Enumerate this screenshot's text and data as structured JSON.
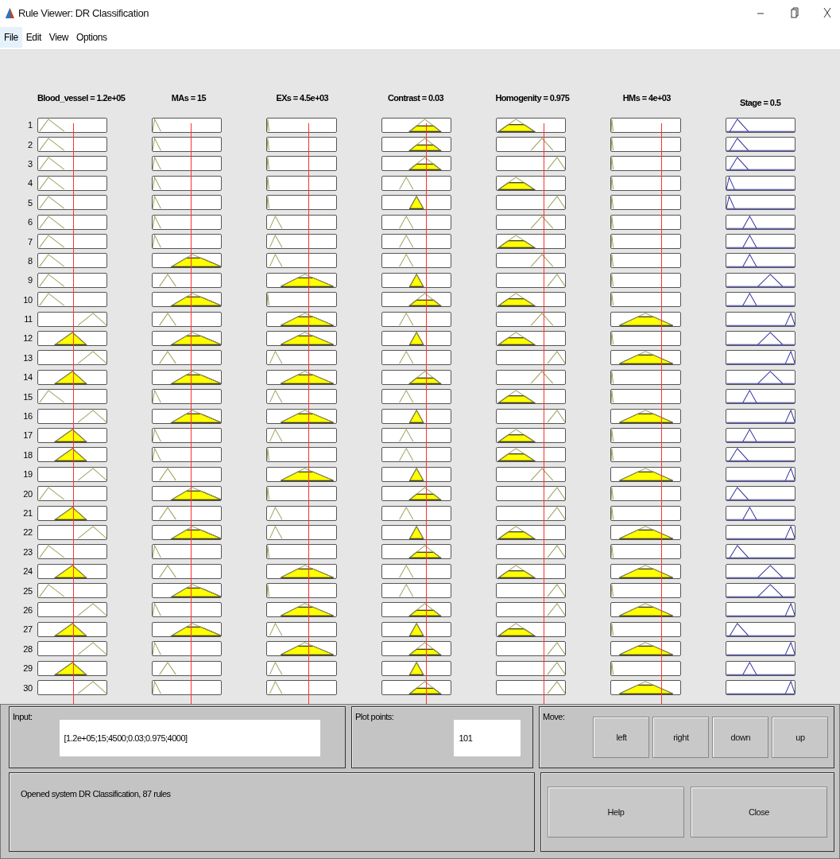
{
  "window": {
    "title": "Rule Viewer: DR Classification"
  },
  "menu": [
    {
      "label": "File",
      "selected": true
    },
    {
      "label": "Edit",
      "selected": false
    },
    {
      "label": "View",
      "selected": false
    },
    {
      "label": "Options",
      "selected": false
    }
  ],
  "variables": [
    {
      "label": "Blood_vessel = 1.2e+05",
      "kind": "input"
    },
    {
      "label": "MAs = 15",
      "kind": "input"
    },
    {
      "label": "EXs = 4.5e+03",
      "kind": "input"
    },
    {
      "label": "Contrast = 0.03",
      "kind": "input"
    },
    {
      "label": "Homogenity = 0.975",
      "kind": "input"
    },
    {
      "label": "HMs = 4e+03",
      "kind": "input"
    },
    {
      "label": "Stage = 0.5",
      "kind": "output"
    }
  ],
  "rules": [
    {
      "number": "1",
      "cells": [
        {
          "kind": "low",
          "fired": false
        },
        {
          "kind": "edge",
          "fired": false
        },
        {
          "kind": "edge",
          "fired": false
        },
        {
          "kind": "high",
          "fired": true
        },
        {
          "kind": "low",
          "fired": true
        },
        {
          "kind": "edge",
          "fired": false
        },
        {
          "kind": "s1"
        }
      ]
    },
    {
      "number": "2",
      "cells": [
        {
          "kind": "low",
          "fired": false
        },
        {
          "kind": "edge",
          "fired": false
        },
        {
          "kind": "edge",
          "fired": false
        },
        {
          "kind": "high",
          "fired": true
        },
        {
          "kind": "mid",
          "fired": false
        },
        {
          "kind": "edge",
          "fired": false
        },
        {
          "kind": "s1"
        }
      ]
    },
    {
      "number": "3",
      "cells": [
        {
          "kind": "low",
          "fired": false
        },
        {
          "kind": "edge",
          "fired": false
        },
        {
          "kind": "edge",
          "fired": false
        },
        {
          "kind": "high",
          "fired": true
        },
        {
          "kind": "high",
          "fired": false
        },
        {
          "kind": "edge",
          "fired": false
        },
        {
          "kind": "s1"
        }
      ]
    },
    {
      "number": "4",
      "cells": [
        {
          "kind": "low",
          "fired": false
        },
        {
          "kind": "edge",
          "fired": false
        },
        {
          "kind": "edge",
          "fired": false
        },
        {
          "kind": "low",
          "fired": false
        },
        {
          "kind": "low",
          "fired": true
        },
        {
          "kind": "edge",
          "fired": false
        },
        {
          "kind": "s0"
        }
      ]
    },
    {
      "number": "5",
      "cells": [
        {
          "kind": "low",
          "fired": false
        },
        {
          "kind": "edge",
          "fired": false
        },
        {
          "kind": "edge",
          "fired": false
        },
        {
          "kind": "mid",
          "fired": true
        },
        {
          "kind": "high",
          "fired": false
        },
        {
          "kind": "edge",
          "fired": false
        },
        {
          "kind": "s0"
        }
      ]
    },
    {
      "number": "6",
      "cells": [
        {
          "kind": "low",
          "fired": false
        },
        {
          "kind": "edge",
          "fired": false
        },
        {
          "kind": "low",
          "fired": false
        },
        {
          "kind": "low",
          "fired": false
        },
        {
          "kind": "mid",
          "fired": false
        },
        {
          "kind": "edge",
          "fired": false
        },
        {
          "kind": "s2"
        }
      ]
    },
    {
      "number": "7",
      "cells": [
        {
          "kind": "low",
          "fired": false
        },
        {
          "kind": "edge",
          "fired": false
        },
        {
          "kind": "low",
          "fired": false
        },
        {
          "kind": "low",
          "fired": false
        },
        {
          "kind": "low",
          "fired": true
        },
        {
          "kind": "edge",
          "fired": false
        },
        {
          "kind": "s2"
        }
      ]
    },
    {
      "number": "8",
      "cells": [
        {
          "kind": "low",
          "fired": false
        },
        {
          "kind": "wide",
          "fired": true
        },
        {
          "kind": "low",
          "fired": false
        },
        {
          "kind": "low",
          "fired": false
        },
        {
          "kind": "mid",
          "fired": false
        },
        {
          "kind": "edge",
          "fired": false
        },
        {
          "kind": "s2"
        }
      ]
    },
    {
      "number": "9",
      "cells": [
        {
          "kind": "low",
          "fired": false
        },
        {
          "kind": "low",
          "fired": false
        },
        {
          "kind": "wide",
          "fired": true
        },
        {
          "kind": "mid",
          "fired": true
        },
        {
          "kind": "high",
          "fired": false
        },
        {
          "kind": "edge",
          "fired": false
        },
        {
          "kind": "s3"
        }
      ]
    },
    {
      "number": "10",
      "cells": [
        {
          "kind": "low",
          "fired": false
        },
        {
          "kind": "wide",
          "fired": true
        },
        {
          "kind": "edge",
          "fired": false
        },
        {
          "kind": "high",
          "fired": true
        },
        {
          "kind": "low",
          "fired": true
        },
        {
          "kind": "edge",
          "fired": false
        },
        {
          "kind": "s2"
        }
      ]
    },
    {
      "number": "11",
      "cells": [
        {
          "kind": "high",
          "fired": false
        },
        {
          "kind": "low",
          "fired": false
        },
        {
          "kind": "wide",
          "fired": true
        },
        {
          "kind": "low",
          "fired": false
        },
        {
          "kind": "mid",
          "fired": false
        },
        {
          "kind": "wide",
          "fired": true
        },
        {
          "kind": "s4"
        }
      ]
    },
    {
      "number": "12",
      "cells": [
        {
          "kind": "mid",
          "fired": true
        },
        {
          "kind": "wide",
          "fired": true
        },
        {
          "kind": "wide",
          "fired": true
        },
        {
          "kind": "mid",
          "fired": true
        },
        {
          "kind": "low",
          "fired": true
        },
        {
          "kind": "edge",
          "fired": false
        },
        {
          "kind": "s3"
        }
      ]
    },
    {
      "number": "13",
      "cells": [
        {
          "kind": "high",
          "fired": false
        },
        {
          "kind": "low",
          "fired": false
        },
        {
          "kind": "low",
          "fired": false
        },
        {
          "kind": "low",
          "fired": false
        },
        {
          "kind": "high",
          "fired": false
        },
        {
          "kind": "wide",
          "fired": true
        },
        {
          "kind": "s4"
        }
      ]
    },
    {
      "number": "14",
      "cells": [
        {
          "kind": "mid",
          "fired": true
        },
        {
          "kind": "wide",
          "fired": true
        },
        {
          "kind": "wide",
          "fired": true
        },
        {
          "kind": "high",
          "fired": true
        },
        {
          "kind": "mid",
          "fired": false
        },
        {
          "kind": "edge",
          "fired": false
        },
        {
          "kind": "s3"
        }
      ]
    },
    {
      "number": "15",
      "cells": [
        {
          "kind": "low",
          "fired": false
        },
        {
          "kind": "edge",
          "fired": false
        },
        {
          "kind": "low",
          "fired": false
        },
        {
          "kind": "low",
          "fired": false
        },
        {
          "kind": "low",
          "fired": true
        },
        {
          "kind": "edge",
          "fired": false
        },
        {
          "kind": "s2"
        }
      ]
    },
    {
      "number": "16",
      "cells": [
        {
          "kind": "high",
          "fired": false
        },
        {
          "kind": "wide",
          "fired": true
        },
        {
          "kind": "wide",
          "fired": true
        },
        {
          "kind": "mid",
          "fired": true
        },
        {
          "kind": "high",
          "fired": false
        },
        {
          "kind": "wide",
          "fired": true
        },
        {
          "kind": "s4"
        }
      ]
    },
    {
      "number": "17",
      "cells": [
        {
          "kind": "mid",
          "fired": true
        },
        {
          "kind": "edge",
          "fired": false
        },
        {
          "kind": "low",
          "fired": false
        },
        {
          "kind": "low",
          "fired": false
        },
        {
          "kind": "low",
          "fired": true
        },
        {
          "kind": "edge",
          "fired": false
        },
        {
          "kind": "s2"
        }
      ]
    },
    {
      "number": "18",
      "cells": [
        {
          "kind": "mid",
          "fired": true
        },
        {
          "kind": "edge",
          "fired": false
        },
        {
          "kind": "edge",
          "fired": false
        },
        {
          "kind": "low",
          "fired": false
        },
        {
          "kind": "low",
          "fired": true
        },
        {
          "kind": "edge",
          "fired": false
        },
        {
          "kind": "s1"
        }
      ]
    },
    {
      "number": "19",
      "cells": [
        {
          "kind": "high",
          "fired": false
        },
        {
          "kind": "low",
          "fired": false
        },
        {
          "kind": "wide",
          "fired": true
        },
        {
          "kind": "mid",
          "fired": true
        },
        {
          "kind": "mid",
          "fired": false
        },
        {
          "kind": "wide",
          "fired": true
        },
        {
          "kind": "s4"
        }
      ]
    },
    {
      "number": "20",
      "cells": [
        {
          "kind": "low",
          "fired": false
        },
        {
          "kind": "wide",
          "fired": true
        },
        {
          "kind": "edge",
          "fired": false
        },
        {
          "kind": "high",
          "fired": true
        },
        {
          "kind": "high",
          "fired": false
        },
        {
          "kind": "edge",
          "fired": false
        },
        {
          "kind": "s1"
        }
      ]
    },
    {
      "number": "21",
      "cells": [
        {
          "kind": "mid",
          "fired": true
        },
        {
          "kind": "low",
          "fired": false
        },
        {
          "kind": "low",
          "fired": false
        },
        {
          "kind": "low",
          "fired": false
        },
        {
          "kind": "high",
          "fired": false
        },
        {
          "kind": "edge",
          "fired": false
        },
        {
          "kind": "s2"
        }
      ]
    },
    {
      "number": "22",
      "cells": [
        {
          "kind": "high",
          "fired": false
        },
        {
          "kind": "wide",
          "fired": true
        },
        {
          "kind": "low",
          "fired": false
        },
        {
          "kind": "mid",
          "fired": true
        },
        {
          "kind": "low",
          "fired": true
        },
        {
          "kind": "wide",
          "fired": true
        },
        {
          "kind": "s4"
        }
      ]
    },
    {
      "number": "23",
      "cells": [
        {
          "kind": "low",
          "fired": false
        },
        {
          "kind": "edge",
          "fired": false
        },
        {
          "kind": "edge",
          "fired": false
        },
        {
          "kind": "high",
          "fired": true
        },
        {
          "kind": "high",
          "fired": false
        },
        {
          "kind": "edge",
          "fired": false
        },
        {
          "kind": "s1"
        }
      ]
    },
    {
      "number": "24",
      "cells": [
        {
          "kind": "mid",
          "fired": true
        },
        {
          "kind": "low",
          "fired": false
        },
        {
          "kind": "wide",
          "fired": true
        },
        {
          "kind": "low",
          "fired": false
        },
        {
          "kind": "low",
          "fired": true
        },
        {
          "kind": "wide",
          "fired": true
        },
        {
          "kind": "s3"
        }
      ]
    },
    {
      "number": "25",
      "cells": [
        {
          "kind": "low",
          "fired": false
        },
        {
          "kind": "wide",
          "fired": true
        },
        {
          "kind": "edge",
          "fired": false
        },
        {
          "kind": "low",
          "fired": false
        },
        {
          "kind": "high",
          "fired": false
        },
        {
          "kind": "edge",
          "fired": false
        },
        {
          "kind": "s3"
        }
      ]
    },
    {
      "number": "26",
      "cells": [
        {
          "kind": "high",
          "fired": false
        },
        {
          "kind": "edge",
          "fired": false
        },
        {
          "kind": "wide",
          "fired": true
        },
        {
          "kind": "high",
          "fired": true
        },
        {
          "kind": "high",
          "fired": false
        },
        {
          "kind": "wide",
          "fired": true
        },
        {
          "kind": "s4"
        }
      ]
    },
    {
      "number": "27",
      "cells": [
        {
          "kind": "mid",
          "fired": true
        },
        {
          "kind": "wide",
          "fired": true
        },
        {
          "kind": "low",
          "fired": false
        },
        {
          "kind": "mid",
          "fired": true
        },
        {
          "kind": "low",
          "fired": true
        },
        {
          "kind": "edge",
          "fired": false
        },
        {
          "kind": "s1"
        }
      ]
    },
    {
      "number": "28",
      "cells": [
        {
          "kind": "high",
          "fired": false
        },
        {
          "kind": "edge",
          "fired": false
        },
        {
          "kind": "wide",
          "fired": true
        },
        {
          "kind": "high",
          "fired": true
        },
        {
          "kind": "high",
          "fired": false
        },
        {
          "kind": "wide",
          "fired": true
        },
        {
          "kind": "s4"
        }
      ]
    },
    {
      "number": "29",
      "cells": [
        {
          "kind": "mid",
          "fired": true
        },
        {
          "kind": "low",
          "fired": false
        },
        {
          "kind": "low",
          "fired": false
        },
        {
          "kind": "mid",
          "fired": true
        },
        {
          "kind": "high",
          "fired": false
        },
        {
          "kind": "edge",
          "fired": false
        },
        {
          "kind": "s2"
        }
      ]
    },
    {
      "number": "30",
      "cells": [
        {
          "kind": "high",
          "fired": false
        },
        {
          "kind": "edge",
          "fired": false
        },
        {
          "kind": "low",
          "fired": false
        },
        {
          "kind": "high",
          "fired": true
        },
        {
          "kind": "high",
          "fired": false
        },
        {
          "kind": "wide",
          "fired": true
        },
        {
          "kind": "s4"
        }
      ]
    }
  ],
  "input": {
    "label": "Input:",
    "value": "[1.2e+05;15;4500;0.03;0.975;4000]"
  },
  "plot_points": {
    "label": "Plot points:",
    "value": "101"
  },
  "move": {
    "label": "Move:",
    "buttons": [
      "left",
      "right",
      "down",
      "up"
    ]
  },
  "status": "Opened system DR Classification, 87 rules",
  "buttons": [
    "Help",
    "Close"
  ]
}
